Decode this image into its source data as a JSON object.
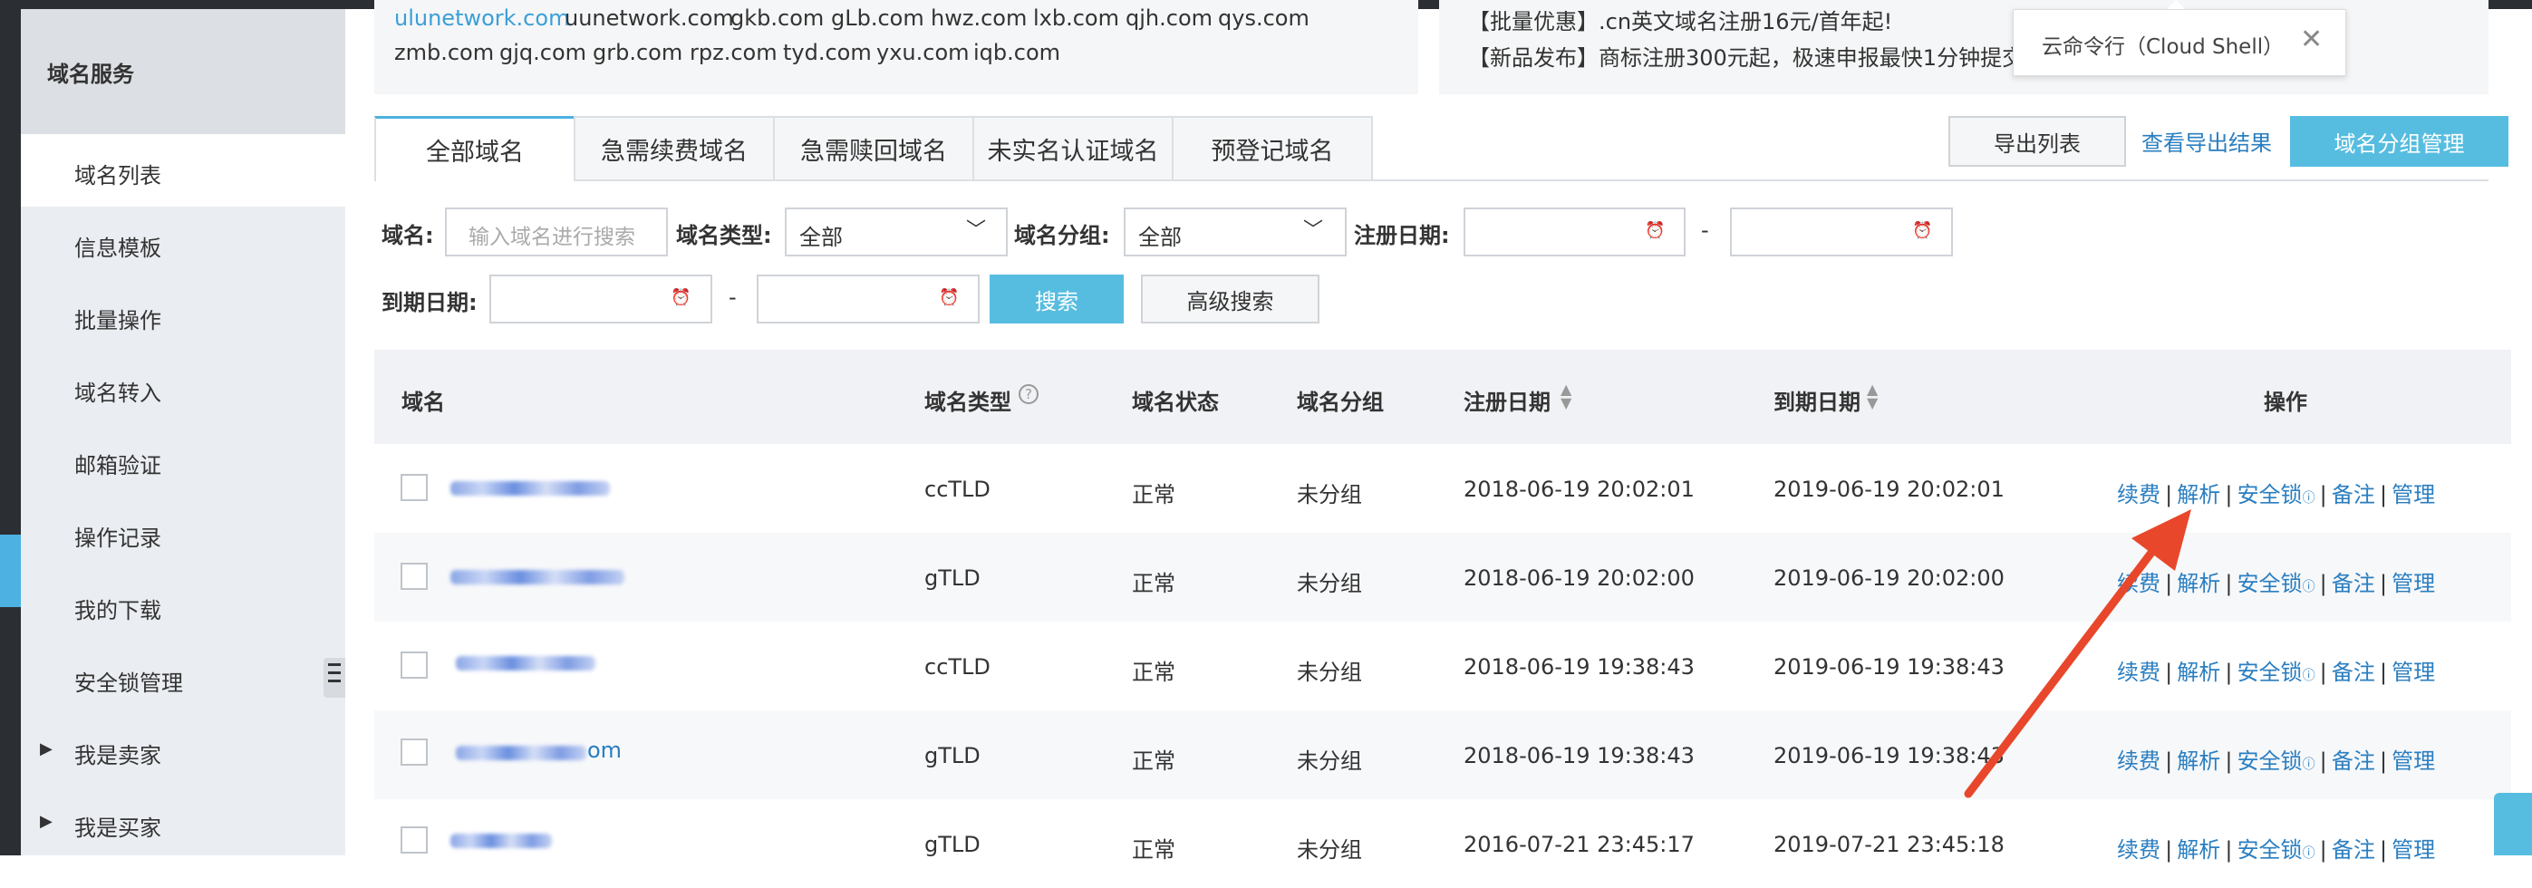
{
  "sidebar": {
    "title": "域名服务",
    "items": [
      {
        "label": "域名列表",
        "active": true
      },
      {
        "label": "信息模板"
      },
      {
        "label": "批量操作"
      },
      {
        "label": "域名转入"
      },
      {
        "label": "邮箱验证"
      },
      {
        "label": "操作记录"
      },
      {
        "label": "我的下载"
      },
      {
        "label": "安全锁管理"
      },
      {
        "label": "我是卖家",
        "expandable": true
      },
      {
        "label": "我是买家",
        "expandable": true
      }
    ]
  },
  "notice_left": {
    "row1": [
      "ulunetwork.com",
      "uunetwork.com",
      "gkb.com",
      "gLb.com",
      "hwz.com",
      "lxb.com",
      "qjh.com",
      "qys.com"
    ],
    "row2": [
      "zmb.com",
      "gjq.com",
      "grb.com",
      "rpz.com",
      "tyd.com",
      "yxu.com",
      "iqb.com"
    ]
  },
  "notice_right": {
    "line1": "【批量优惠】.cn英文域名注册16元/首年起!",
    "line2": "【新品发布】商标注册300元起，极速申报最快1分钟提交"
  },
  "tooltip": {
    "text": "云命令行（Cloud Shell）",
    "close": "✕"
  },
  "tabs": [
    "全部域名",
    "急需续费域名",
    "急需赎回域名",
    "未实名认证域名",
    "预登记域名"
  ],
  "actions": {
    "export": "导出列表",
    "view_export": "查看导出结果",
    "group_manage": "域名分组管理"
  },
  "filters": {
    "domain_label": "域名:",
    "domain_placeholder": "输入域名进行搜索",
    "type_label": "域名类型:",
    "type_value": "全部",
    "group_label": "域名分组:",
    "group_value": "全部",
    "reg_label": "注册日期:",
    "dash": "-",
    "exp_label": "到期日期:",
    "search": "搜索",
    "advanced": "高级搜索"
  },
  "table": {
    "headers": {
      "domain": "域名",
      "type": "域名类型",
      "status": "域名状态",
      "group": "域名分组",
      "reg": "注册日期",
      "exp": "到期日期",
      "ops": "操作"
    },
    "rows": [
      {
        "suffix": "",
        "type": "ccTLD",
        "status": "正常",
        "group": "未分组",
        "reg": "2018-06-19 20:02:01",
        "exp": "2019-06-19 20:02:01"
      },
      {
        "suffix": "",
        "type": "gTLD",
        "status": "正常",
        "group": "未分组",
        "reg": "2018-06-19 20:02:00",
        "exp": "2019-06-19 20:02:00"
      },
      {
        "suffix": "",
        "type": "ccTLD",
        "status": "正常",
        "group": "未分组",
        "reg": "2018-06-19 19:38:43",
        "exp": "2019-06-19 19:38:43"
      },
      {
        "suffix": "om",
        "type": "gTLD",
        "status": "正常",
        "group": "未分组",
        "reg": "2018-06-19 19:38:43",
        "exp": "2019-06-19 19:38:43"
      },
      {
        "suffix": "",
        "type": "gTLD",
        "status": "正常",
        "group": "未分组",
        "reg": "2016-07-21 23:45:17",
        "exp": "2019-07-21 23:45:18"
      }
    ],
    "ops": {
      "renew": "续费",
      "resolve": "解析",
      "lock": "安全锁",
      "note": "备注",
      "manage": "管理",
      "sep": "|"
    }
  },
  "colors": {
    "accent": "#4db1e1",
    "link": "#2a7ec0",
    "arrow": "#e8472b"
  },
  "icons": [
    "help-circle-icon",
    "sort-icon",
    "clock-icon",
    "chevron-down-icon",
    "close-icon",
    "chat-icon"
  ]
}
